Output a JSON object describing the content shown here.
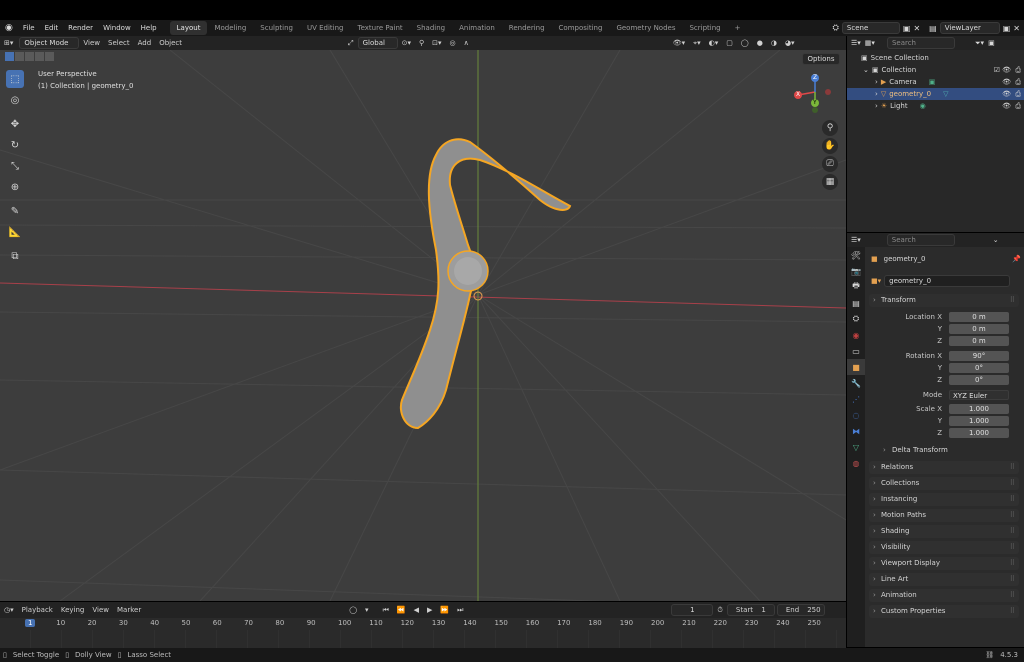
{
  "menubar": {
    "items": [
      "File",
      "Edit",
      "Render",
      "Window",
      "Help"
    ],
    "workspaces": [
      "Layout",
      "Modeling",
      "Sculpting",
      "UV Editing",
      "Texture Paint",
      "Shading",
      "Animation",
      "Rendering",
      "Compositing",
      "Geometry Nodes",
      "Scripting",
      "+"
    ],
    "active_workspace": "Layout",
    "scene": "Scene",
    "view_layer": "ViewLayer"
  },
  "viewport_header": {
    "mode": "Object Mode",
    "menus": [
      "View",
      "Select",
      "Add",
      "Object"
    ],
    "orientation": "Global",
    "options": "Options"
  },
  "viewport": {
    "perspective": "User Perspective",
    "collection_info": "(1) Collection | geometry_0",
    "gizmo": {
      "x": "X",
      "y": "Y",
      "z": "Z"
    }
  },
  "outliner": {
    "search_placeholder": "Search",
    "rows": [
      {
        "label": "Scene Collection"
      },
      {
        "label": "Collection"
      },
      {
        "label": "Camera"
      },
      {
        "label": "geometry_0"
      },
      {
        "label": "Light"
      }
    ]
  },
  "properties": {
    "search_placeholder": "Search",
    "object_name": "geometry_0",
    "data_name": "geometry_0",
    "transform_label": "Transform",
    "location": {
      "label_x": "Location X",
      "label_y": "Y",
      "label_z": "Z",
      "x": "0 m",
      "y": "0 m",
      "z": "0 m"
    },
    "rotation": {
      "label_x": "Rotation X",
      "label_y": "Y",
      "label_z": "Z",
      "x": "90°",
      "y": "0°",
      "z": "0°"
    },
    "mode": {
      "label": "Mode",
      "value": "XYZ Euler"
    },
    "scale": {
      "label_x": "Scale X",
      "label_y": "Y",
      "label_z": "Z",
      "x": "1.000",
      "y": "1.000",
      "z": "1.000"
    },
    "delta_transform": "Delta Transform",
    "panels": [
      "Relations",
      "Collections",
      "Instancing",
      "Motion Paths",
      "Shading",
      "Visibility",
      "Viewport Display",
      "Line Art",
      "Animation",
      "Custom Properties"
    ]
  },
  "timeline": {
    "menus": [
      "Playback",
      "Keying",
      "View",
      "Marker"
    ],
    "current_frame": "1",
    "start_label": "Start",
    "start": "1",
    "end_label": "End",
    "end": "250",
    "ruler": [
      "1",
      "10",
      "20",
      "30",
      "40",
      "50",
      "60",
      "70",
      "80",
      "90",
      "100",
      "110",
      "120",
      "130",
      "140",
      "150",
      "160",
      "170",
      "180",
      "190",
      "200",
      "210",
      "220",
      "230",
      "240",
      "250"
    ]
  },
  "statusbar": {
    "select_toggle": "Select Toggle",
    "dolly_view": "Dolly View",
    "lasso_select": "Lasso Select",
    "version": "4.5.3"
  },
  "colors": {
    "accent": "#4772b3",
    "selection_outline": "#f5a623",
    "x_axis": "#e04848",
    "y_axis": "#7bb83a",
    "z_axis": "#4a7fd6"
  }
}
